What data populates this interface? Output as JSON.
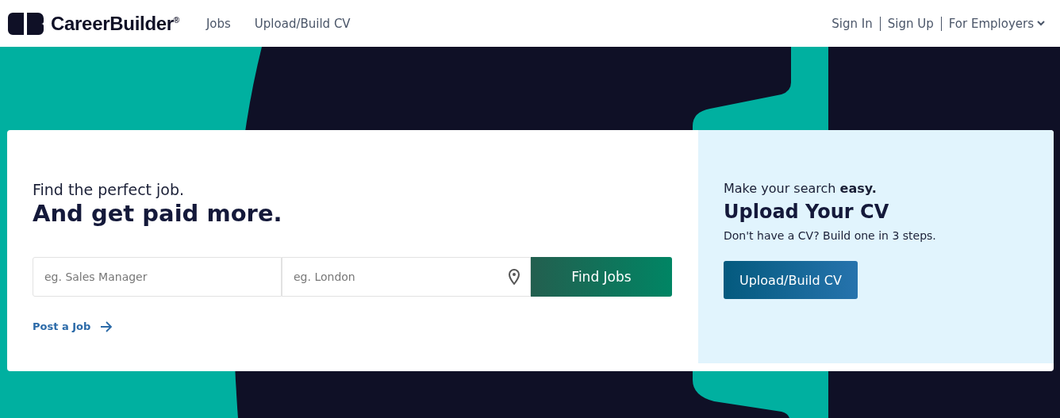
{
  "header": {
    "logo": "CareerBuilder",
    "logo_mark": "®",
    "nav": [
      {
        "label": "Jobs"
      },
      {
        "label": "Upload/Build CV"
      }
    ],
    "account": [
      {
        "label": "Sign In"
      },
      {
        "label": "Sign Up"
      }
    ],
    "employers": "For Employers"
  },
  "search": {
    "intro": "Find the perfect job.",
    "headline": "And get paid more.",
    "keyword": {
      "placeholder": "eg. Sales Manager"
    },
    "location": {
      "placeholder": "eg. London"
    },
    "button": "Find Jobs",
    "post_link": "Post a Job"
  },
  "cv_panel": {
    "intro": "Make your search **easy.**",
    "title": "Upload Your CV",
    "text": "Don't have a CV? Build one in 3 steps.",
    "button": "Upload/Build CV"
  }
}
